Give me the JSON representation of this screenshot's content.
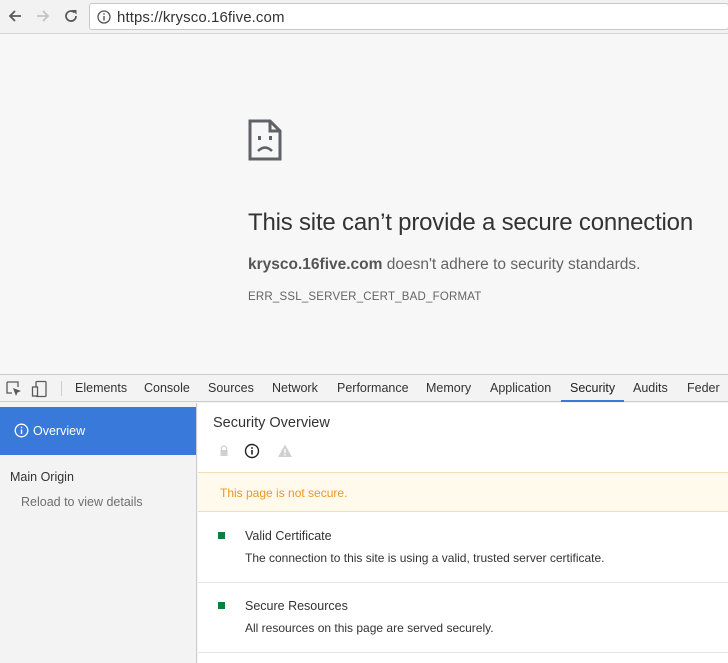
{
  "browser": {
    "url": "https://krysco.16five.com"
  },
  "error_page": {
    "title": "This site can’t provide a secure connection",
    "host": "krysco.16five.com",
    "desc_rest": " doesn't adhere to security standards.",
    "code": "ERR_SSL_SERVER_CERT_BAD_FORMAT"
  },
  "devtools": {
    "tabs": [
      "Elements",
      "Console",
      "Sources",
      "Network",
      "Performance",
      "Memory",
      "Application",
      "Security",
      "Audits",
      "Feder"
    ],
    "active_tab": "Security",
    "sidebar": {
      "overview": "Overview",
      "main_origin": "Main Origin",
      "reload_details": "Reload to view details"
    },
    "main": {
      "title": "Security Overview",
      "status": "This page is not secure.",
      "items": [
        {
          "title": "Valid Certificate",
          "desc": "The connection to this site is using a valid, trusted server certificate."
        },
        {
          "title": "Secure Resources",
          "desc": "All resources on this page are served securely."
        }
      ]
    }
  },
  "colors": {
    "accent": "#3879d9",
    "warning_text": "#ed9726",
    "secure_green": "#0b8043"
  }
}
